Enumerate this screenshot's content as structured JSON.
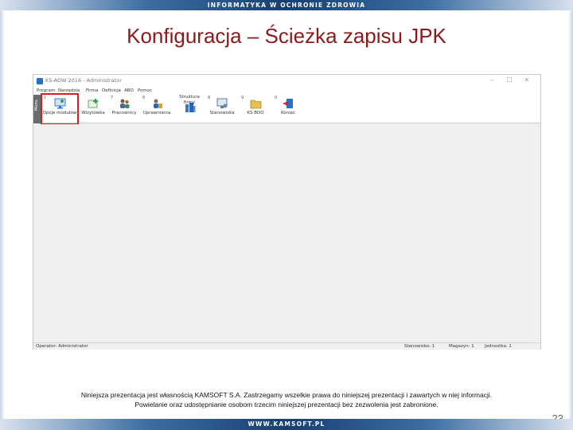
{
  "slide": {
    "top_banner": "INFORMATYKA W OCHRONIE ZDROWIA",
    "title": "Konfiguracja – Ścieżka zapisu JPK",
    "footer_line1": "Niniejsza prezentacja jest własnością KAMSOFT S.A. Zastrzegamy wszelkie prawa do niniejszej prezentacji i zawartych w niej informacji.",
    "footer_line2": "Powielanie oraz udostępnianie osobom trzecim niniejszej prezentacji bez zezwolenia jest zabronione.",
    "bottom_banner": "WWW.KAMSOFT.PL",
    "page_number": "23"
  },
  "app": {
    "window_title": "KS-AOW 2016 - Administrator",
    "window_buttons": [
      "–",
      "☐",
      "✕"
    ],
    "menu": [
      "Program",
      "Narzędzia",
      "Firma",
      "Definicje",
      "ABO",
      "Pomoc"
    ],
    "toolbar_grip": "Menu",
    "toolbar": [
      {
        "num": "1",
        "label": "Opcje modułów",
        "icon": "options-monitor-icon"
      },
      {
        "num": "",
        "label": "Wizytówka",
        "icon": "card-plus-icon"
      },
      {
        "num": "7",
        "label": "Pracownicy",
        "icon": "employees-icon"
      },
      {
        "num": "6",
        "label": "Uprawnienia",
        "icon": "permissions-icon"
      },
      {
        "num": "",
        "label": "Struktura firmy",
        "icon": "structure-icon"
      },
      {
        "num": "8",
        "label": "Stanowiska",
        "icon": "workstation-icon"
      },
      {
        "num": "9",
        "label": "KS BDO",
        "icon": "folder-icon"
      },
      {
        "num": "0",
        "label": "Koniec",
        "icon": "exit-door-icon"
      }
    ],
    "status": {
      "operator": "Operator: Administrator",
      "workstation": "Stanowisko: 1",
      "warehouse": "Magazyn: 1",
      "unit": "Jednostka: 1"
    }
  }
}
